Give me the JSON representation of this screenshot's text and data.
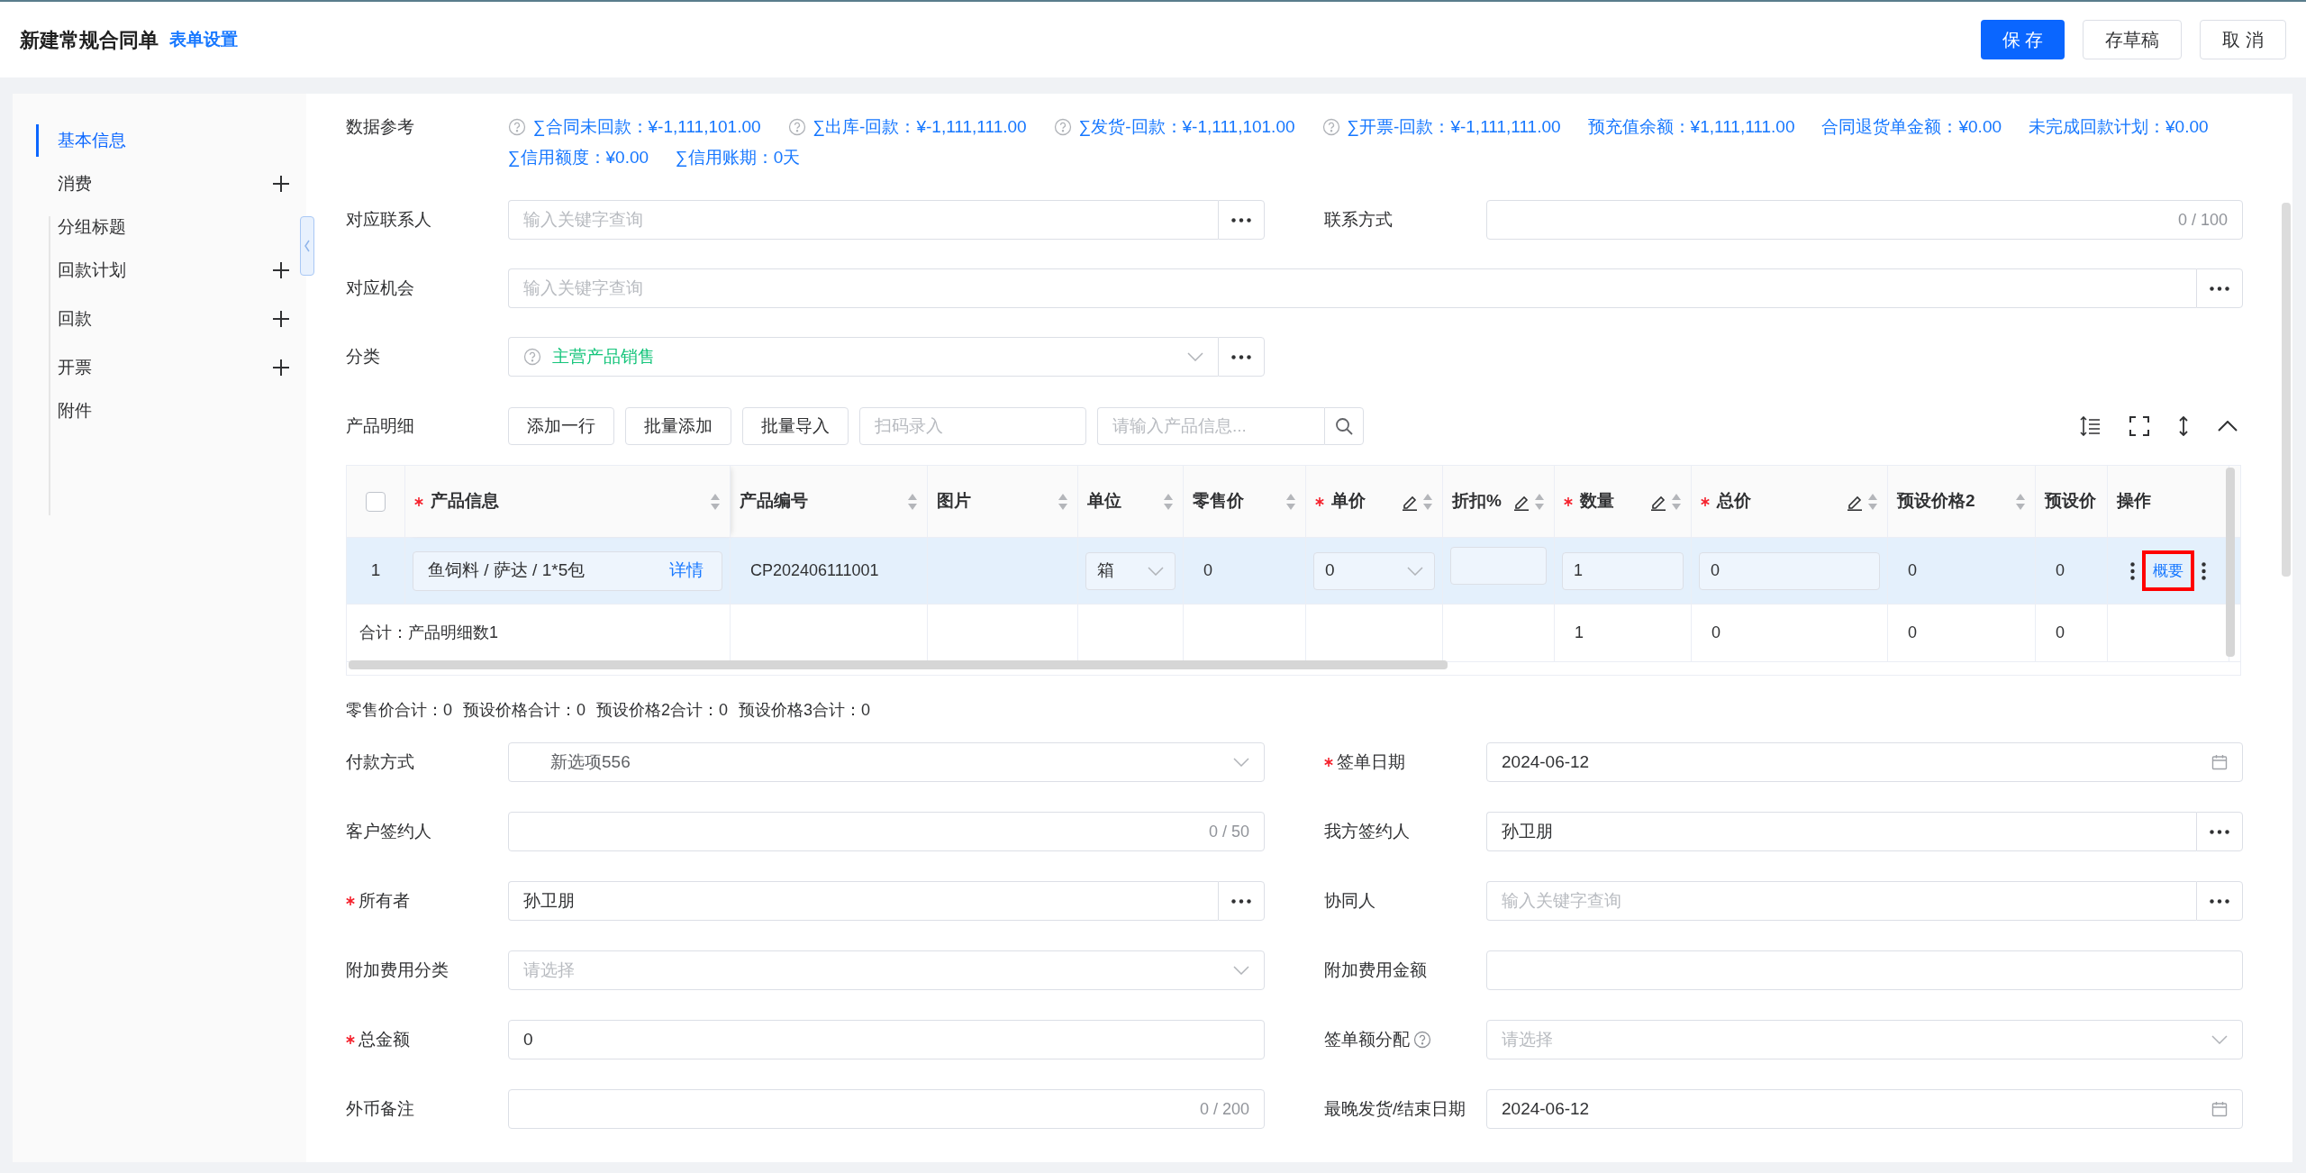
{
  "header": {
    "title": "新建常规合同单",
    "settings_link": "表单设置",
    "buttons": [
      {
        "label": "保 存",
        "primary": true
      },
      {
        "label": "存草稿",
        "primary": false
      },
      {
        "label": "取 消",
        "primary": false
      }
    ]
  },
  "sidebar": {
    "items": [
      {
        "label": "基本信息",
        "selected": true,
        "addable": false
      },
      {
        "label": "消费",
        "selected": false,
        "addable": true
      },
      {
        "label": "分组标题",
        "selected": false,
        "addable": false
      },
      {
        "label": "回款计划",
        "selected": false,
        "addable": true
      },
      {
        "label": "回款",
        "selected": false,
        "addable": true
      },
      {
        "label": "开票",
        "selected": false,
        "addable": true
      },
      {
        "label": "附件",
        "selected": false,
        "addable": false
      }
    ]
  },
  "data_reference": {
    "label": "数据参考",
    "lines": [
      [
        {
          "text": "∑合同未回款：¥-1,111,101.00",
          "help": true
        },
        {
          "text": "∑出库-回款：¥-1,111,111.00",
          "help": true
        },
        {
          "text": "∑发货-回款：¥-1,111,101.00",
          "help": true
        },
        {
          "text": "∑开票-回款：¥-1,111,111.00",
          "help": true
        },
        {
          "text": "预充值余额：¥1,111,111.00",
          "help": false
        },
        {
          "text": "合同退货单金额：¥0.00",
          "help": false
        },
        {
          "text": "未完成回款计划：¥0.00",
          "help": false
        }
      ],
      [
        {
          "text": "∑信用额度：¥0.00",
          "help": false
        },
        {
          "text": "∑信用账期：0天",
          "help": false
        }
      ]
    ]
  },
  "top_rows": [
    {
      "fields": [
        {
          "label": "对应联系人",
          "kind": "lookup",
          "placeholder": "输入关键字查询"
        },
        {
          "label": "联系方式",
          "kind": "text",
          "counter": "0 / 100"
        }
      ]
    },
    {
      "fields": [
        {
          "label": "对应机会",
          "kind": "lookup",
          "placeholder": "输入关键字查询"
        }
      ]
    },
    {
      "fields": [
        {
          "label": "分类",
          "kind": "category",
          "value": "主营产品销售"
        }
      ]
    }
  ],
  "product_section": {
    "label": "产品明细",
    "buttons": [
      "添加一行",
      "批量添加",
      "批量导入"
    ],
    "scan_field": {
      "placeholder": "扫码录入"
    },
    "search_field": {
      "placeholder": "请输入产品信息..."
    }
  },
  "table": {
    "columns": [
      {
        "kind": "checkbox",
        "checked": false
      },
      {
        "label": "产品信息",
        "required": true,
        "editable": false,
        "sortable": true
      },
      {
        "label": "产品编号",
        "required": false,
        "editable": false,
        "sortable": true
      },
      {
        "label": "图片",
        "required": false,
        "editable": false,
        "sortable": true
      },
      {
        "label": "单位",
        "required": false,
        "editable": false,
        "sortable": true
      },
      {
        "label": "零售价",
        "required": false,
        "editable": false,
        "sortable": true
      },
      {
        "label": "单价",
        "required": true,
        "editable": true,
        "sortable": true
      },
      {
        "label": "折扣%",
        "required": false,
        "editable": true,
        "sortable": true
      },
      {
        "label": "数量",
        "required": true,
        "editable": true,
        "sortable": true
      },
      {
        "label": "总价",
        "required": true,
        "editable": true,
        "sortable": true
      },
      {
        "label": "预设价格2",
        "required": false,
        "editable": false,
        "sortable": true
      },
      {
        "label": "预设价",
        "required": false,
        "editable": false,
        "sortable": false
      },
      {
        "label": "操作",
        "required": false,
        "editable": false,
        "sortable": false
      }
    ],
    "rows": [
      {
        "highlighted": true,
        "cells": [
          {
            "kind": "index",
            "text": "1"
          },
          {
            "kind": "product",
            "text": "鱼饲料 / 萨达 / 1*5包",
            "link": "详情"
          },
          {
            "kind": "text",
            "text": "CP202406111001"
          },
          {
            "kind": "empty"
          },
          {
            "kind": "select",
            "text": "箱"
          },
          {
            "kind": "text",
            "text": "0"
          },
          {
            "kind": "select",
            "text": "0"
          },
          {
            "kind": "input"
          },
          {
            "kind": "input",
            "text": "1"
          },
          {
            "kind": "input",
            "text": "0"
          },
          {
            "kind": "text",
            "text": "0"
          },
          {
            "kind": "text",
            "text": "0"
          },
          {
            "kind": "ops",
            "text": "概要",
            "highlighted": true
          }
        ]
      }
    ],
    "totals": [
      {
        "kind": "text",
        "text": "合计：产品明细数1"
      },
      {
        "kind": "empty"
      },
      {
        "kind": "empty"
      },
      {
        "kind": "empty"
      },
      {
        "kind": "empty"
      },
      {
        "kind": "empty"
      },
      {
        "kind": "empty"
      },
      {
        "kind": "text",
        "text": "1"
      },
      {
        "kind": "text",
        "text": "0"
      },
      {
        "kind": "text",
        "text": "0"
      },
      {
        "kind": "text",
        "text": "0"
      },
      {
        "kind": "empty"
      }
    ]
  },
  "summary": [
    "零售价合计：0",
    "预设价格合计：0",
    "预设价格2合计：0",
    "预设价格3合计：0"
  ],
  "bottom_rows": [
    {
      "fields": [
        {
          "label": "付款方式",
          "kind": "select",
          "value": "新选项556"
        },
        {
          "label": "签单日期",
          "required": true,
          "kind": "date",
          "value": "2024-06-12"
        }
      ]
    },
    {
      "fields": [
        {
          "label": "客户签约人",
          "kind": "text",
          "counter": "0 / 50"
        },
        {
          "label": "我方签约人",
          "kind": "lookup",
          "value": "孙卫朋"
        }
      ]
    },
    {
      "fields": [
        {
          "label": "所有者",
          "required": true,
          "kind": "lookup",
          "value": "孙卫朋"
        },
        {
          "label": "协同人",
          "kind": "lookup",
          "placeholder": "输入关键字查询"
        }
      ]
    },
    {
      "fields": [
        {
          "label": "附加费用分类",
          "kind": "select",
          "placeholder": "请选择"
        },
        {
          "label": "附加费用金额",
          "kind": "text"
        }
      ]
    },
    {
      "fields": [
        {
          "label": "总金额",
          "required": true,
          "kind": "text",
          "value": "0"
        },
        {
          "label": "签单额分配",
          "help": true,
          "kind": "select",
          "placeholder": "请选择"
        }
      ]
    },
    {
      "fields": [
        {
          "label": "外币备注",
          "kind": "text",
          "counter": "0 / 200"
        },
        {
          "label": "最晚发货/结束日期",
          "kind": "date",
          "value": "2024-06-12"
        }
      ]
    }
  ]
}
